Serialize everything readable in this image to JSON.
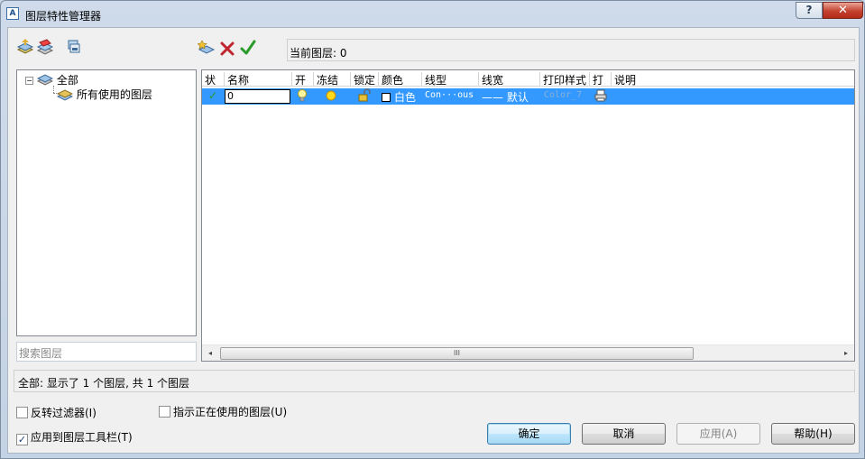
{
  "window": {
    "title": "图层特性管理器",
    "app_icon": "A"
  },
  "titlebar": {
    "help_label": "?",
    "close_label": "✕"
  },
  "toolbar": {
    "left_icons": [
      "new-filter-icon",
      "group-filter-icon",
      "layer-state-icon"
    ],
    "right_icons": [
      "new-layer-icon",
      "delete-layer-icon",
      "set-current-icon"
    ]
  },
  "current_layer": "当前图层: 0",
  "tree": {
    "root": {
      "expander": "−",
      "label": "全部"
    },
    "child": {
      "label": "所有使用的图层"
    }
  },
  "search": {
    "placeholder": "搜索图层"
  },
  "grid": {
    "columns": [
      "状",
      "名称",
      "开",
      "冻结",
      "锁定",
      "颜色",
      "线型",
      "线宽",
      "打印样式",
      "打",
      "说明"
    ],
    "rows": [
      {
        "status": "✓",
        "name": "0",
        "color": "白色",
        "linetype": "Con···ous",
        "lineweight": "—— 默认",
        "plot_style": "Color_7"
      }
    ]
  },
  "hscroll": {
    "left": "◂",
    "right": "▸",
    "thumb": "III"
  },
  "status_text": "全部: 显示了 1 个图层, 共 1 个图层",
  "options": {
    "invert_filter": {
      "label": "反转过滤器(I)",
      "checked": false
    },
    "indicate_in_use": {
      "label": "指示正在使用的图层(U)",
      "checked": false
    },
    "apply_to_toolbar": {
      "label": "应用到图层工具栏(T)",
      "checked": true
    }
  },
  "buttons": {
    "ok": "确定",
    "cancel": "取消",
    "apply": "应用(A)",
    "help": "帮助(H)"
  },
  "colors": {
    "selection": "#3399ff",
    "check_green": "#2a9a2a",
    "delete_red": "#c0262d"
  }
}
